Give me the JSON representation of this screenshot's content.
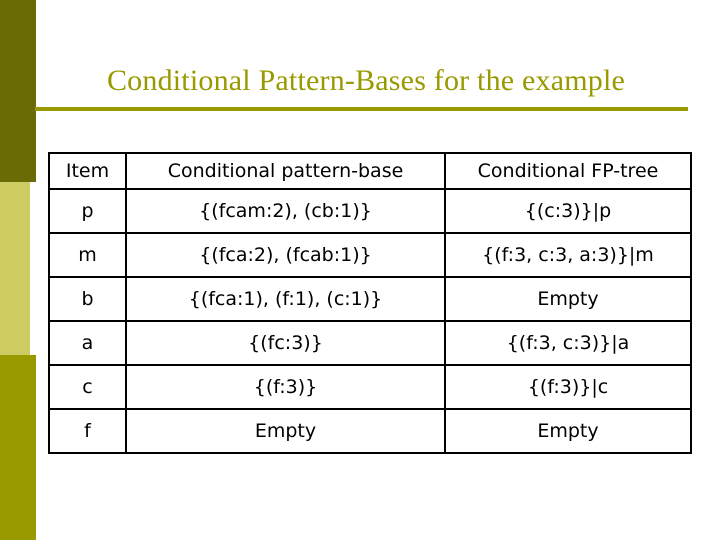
{
  "slide": {
    "title": "Conditional Pattern-Bases for the example",
    "title_color": "#999900",
    "rule_color": "#999900",
    "background_color": "#FFFFFF"
  },
  "sidebar": {
    "bands": [
      {
        "name": "top-band",
        "color": "#6B6B06"
      },
      {
        "name": "middle-band",
        "color": "#CCCC63"
      },
      {
        "name": "bottom-band",
        "color": "#999900"
      }
    ]
  },
  "table": {
    "headers": [
      "Item",
      "Conditional pattern-base",
      "Conditional FP-tree"
    ],
    "rows": [
      {
        "item": "p",
        "base": "{(fcam:2), (cb:1)}",
        "tree": "{(c:3)}|p"
      },
      {
        "item": "m",
        "base": "{(fca:2), (fcab:1)}",
        "tree": "{(f:3, c:3, a:3)}|m"
      },
      {
        "item": "b",
        "base": "{(fca:1), (f:1), (c:1)}",
        "tree": "Empty"
      },
      {
        "item": "a",
        "base": "{(fc:3)}",
        "tree": "{(f:3, c:3)}|a"
      },
      {
        "item": "c",
        "base": "{(f:3)}",
        "tree": "{(f:3)}|c"
      },
      {
        "item": "f",
        "base": "Empty",
        "tree": "Empty"
      }
    ]
  }
}
